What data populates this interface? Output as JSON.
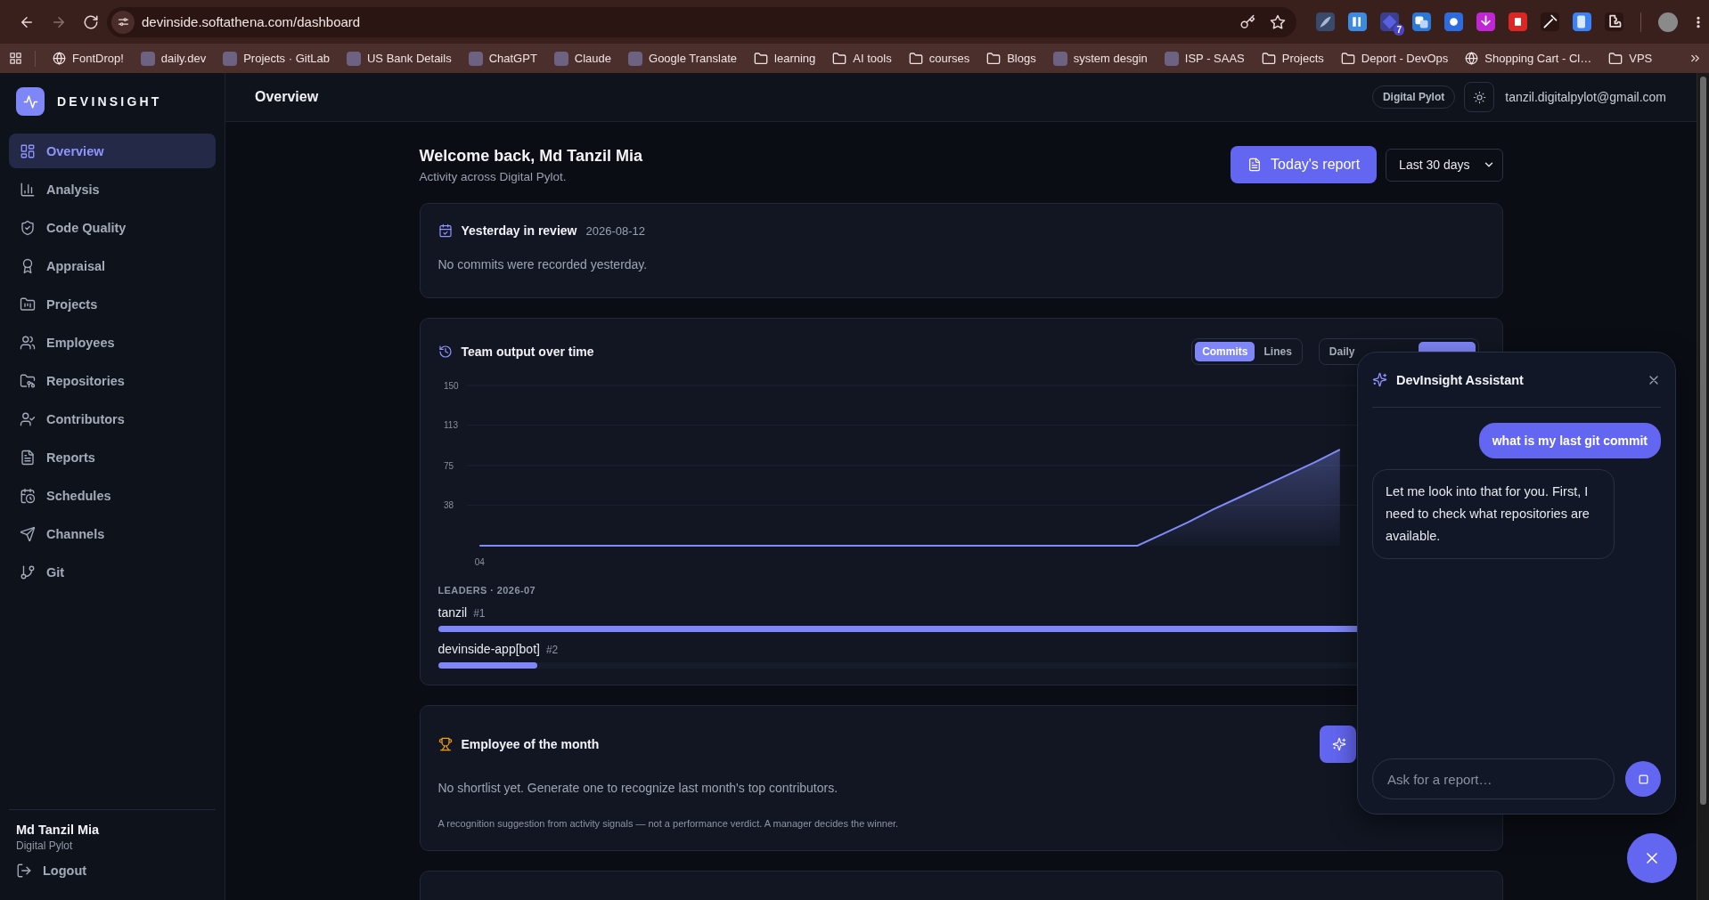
{
  "browser": {
    "url": "devinside.softathena.com/dashboard",
    "extension_badge": "7",
    "bookmarks": [
      {
        "label": "FontDrop!",
        "kind": "globe"
      },
      {
        "label": "daily.dev",
        "kind": "site"
      },
      {
        "label": "Projects · GitLab",
        "kind": "site"
      },
      {
        "label": "US Bank Details",
        "kind": "site"
      },
      {
        "label": "ChatGPT",
        "kind": "site"
      },
      {
        "label": "Claude",
        "kind": "site"
      },
      {
        "label": "Google Translate",
        "kind": "site"
      },
      {
        "label": "learning",
        "kind": "folder"
      },
      {
        "label": "AI tools",
        "kind": "folder"
      },
      {
        "label": "courses",
        "kind": "folder"
      },
      {
        "label": "Blogs",
        "kind": "folder"
      },
      {
        "label": "system desgin",
        "kind": "site"
      },
      {
        "label": "ISP - SAAS",
        "kind": "site"
      },
      {
        "label": "Projects",
        "kind": "folder"
      },
      {
        "label": "Deport - DevOps",
        "kind": "folder"
      },
      {
        "label": "Shopping Cart - Cl…",
        "kind": "globe"
      },
      {
        "label": "VPS",
        "kind": "folder"
      }
    ]
  },
  "sidebar": {
    "brand": "DEVINSIGHT",
    "items": [
      {
        "label": "Overview",
        "selected": true
      },
      {
        "label": "Analysis",
        "selected": false
      },
      {
        "label": "Code Quality",
        "selected": false
      },
      {
        "label": "Appraisal",
        "selected": false
      },
      {
        "label": "Projects",
        "selected": false
      },
      {
        "label": "Employees",
        "selected": false
      },
      {
        "label": "Repositories",
        "selected": false
      },
      {
        "label": "Contributors",
        "selected": false
      },
      {
        "label": "Reports",
        "selected": false
      },
      {
        "label": "Schedules",
        "selected": false
      },
      {
        "label": "Channels",
        "selected": false
      },
      {
        "label": "Git",
        "selected": false
      }
    ],
    "user": {
      "name": "Md Tanzil Mia",
      "org": "Digital Pylot"
    },
    "logout": "Logout"
  },
  "header": {
    "title": "Overview",
    "workspace": "Digital Pylot",
    "email": "tanzil.digitalpylot@gmail.com"
  },
  "welcome": {
    "title": "Welcome back, Md Tanzil Mia",
    "subtitle": "Activity across Digital Pylot.",
    "report_button": "Today's report",
    "range": "Last 30 days"
  },
  "yesterday": {
    "title": "Yesterday in review",
    "date": "2026-08-12",
    "message": "No commits were recorded yesterday."
  },
  "team_output": {
    "title": "Team output over time",
    "metric_tabs": [
      {
        "label": "Commits",
        "selected": true
      },
      {
        "label": "Lines",
        "selected": false
      }
    ],
    "period_tabs": [
      {
        "label": "Daily",
        "selected": false
      },
      {
        "selected": true
      }
    ],
    "chart_data": {
      "type": "area",
      "categories": [
        "04",
        null,
        null,
        null,
        null,
        null,
        null,
        null,
        null,
        null,
        null,
        null,
        null,
        null,
        null,
        null,
        null,
        null,
        null,
        null,
        null,
        null,
        null,
        null,
        null,
        null,
        null,
        null,
        null,
        null,
        null,
        null,
        null,
        null,
        null,
        null,
        null,
        null,
        null,
        null
      ],
      "grid": true,
      "series": [
        {
          "color": "#818cf8",
          "values": [
            0,
            0,
            0,
            0,
            0,
            0,
            0,
            0,
            0,
            0,
            0,
            0,
            0,
            0,
            0,
            0,
            0,
            0,
            0,
            0,
            0,
            0,
            0,
            0,
            0,
            0,
            0,
            11,
            22,
            34,
            45,
            56,
            67,
            78,
            90,
            null,
            null,
            null,
            null,
            null
          ]
        }
      ],
      "ylim": [
        0,
        150
      ],
      "yticks": [
        38,
        75,
        113,
        150
      ]
    },
    "leaders_label": "LEADERS · 2026-07",
    "leaders": [
      {
        "name": "tanzil",
        "rank": "#1",
        "level": 1
      },
      {
        "name": "devinside-app[bot]",
        "rank": "#2",
        "level": 0.095
      }
    ]
  },
  "employee_of_month": {
    "title": "Employee of the month",
    "message": "No shortlist yet. Generate one to recognize last month's top contributors.",
    "note": "A recognition suggestion from activity signals — not a performance verdict. A manager decides the winner."
  },
  "assistant": {
    "title": "DevInsight Assistant",
    "messages": [
      {
        "kind": "user",
        "text": "what is my last git commit"
      },
      {
        "kind": "assistant",
        "text": "Let me look into that for you. First, I need to check what repositories are available."
      }
    ],
    "placeholder": "Ask for a report…"
  }
}
